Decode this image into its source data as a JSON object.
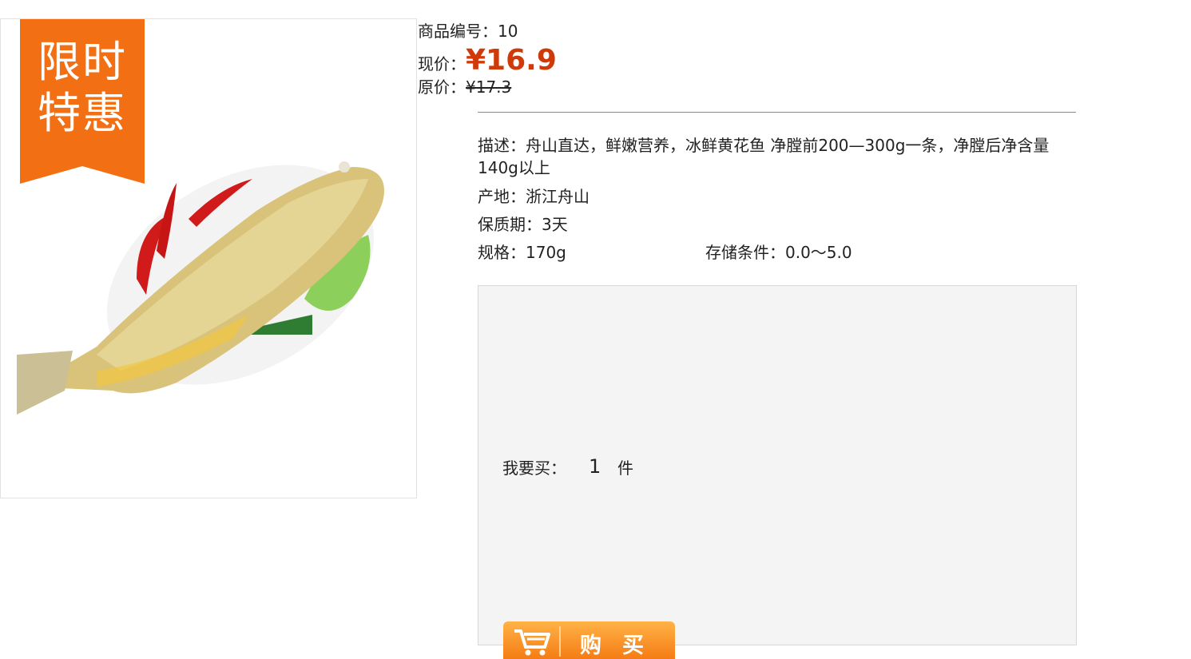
{
  "product": {
    "badge": "限时特惠",
    "image_icon": "fish-image",
    "code_label": "商品编号：",
    "code_value": "10",
    "price_label": "现价：",
    "price_value": "¥16.9",
    "original_label": "原价：",
    "original_value": "¥17.3",
    "accent_color": "#d03a08"
  },
  "details": {
    "description": "描述：舟山直达，鲜嫩营养，冰鲜黄花鱼 净膛前200—300g一条，净膛后净含量140g以上",
    "origin": "产地：浙江舟山",
    "shelf_life": "保质期：3天",
    "spec": "规格：170g",
    "storage": "存储条件：0.0～5.0"
  },
  "purchase": {
    "qty_label": "我要买：",
    "qty_value": "1",
    "qty_unit": "件",
    "buy_label": "购买",
    "cart_icon": "cart-icon",
    "button_color": "#f57c14"
  }
}
